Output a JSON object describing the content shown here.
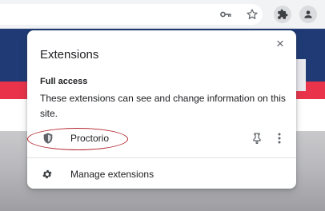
{
  "toolbar": {
    "icons": [
      "key-icon",
      "star-icon",
      "puzzle-icon",
      "profile-icon"
    ]
  },
  "popup": {
    "title": "Extensions",
    "close_label": "×",
    "section_heading": "Full access",
    "description": "These extensions can see and change information on this site.",
    "extension": {
      "name": "Proctorio",
      "icon": "shield-icon"
    },
    "manage_label": "Manage extensions"
  },
  "colors": {
    "highlight": "#b3232e",
    "page_blue": "#1f3a75",
    "page_red": "#e8334a"
  }
}
